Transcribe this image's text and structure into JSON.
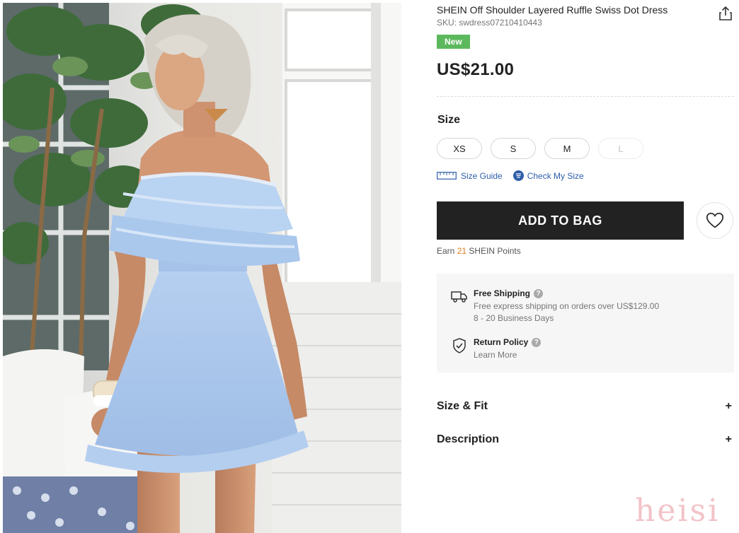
{
  "product": {
    "title": "SHEIN Off Shoulder Layered Ruffle Swiss Dot Dress",
    "sku": "SKU: swdress07210410443",
    "badge": "New",
    "price": "US$21.00",
    "share_icon": "share-icon"
  },
  "size": {
    "label": "Size",
    "options": [
      {
        "label": "XS",
        "available": true
      },
      {
        "label": "S",
        "available": true
      },
      {
        "label": "M",
        "available": true
      },
      {
        "label": "L",
        "available": false
      }
    ],
    "size_guide": "Size Guide",
    "check_my_size": "Check My Size"
  },
  "actions": {
    "add_to_bag": "ADD TO BAG",
    "wishlist_icon": "heart-icon"
  },
  "points": {
    "prefix": "Earn",
    "value": "21",
    "suffix": "SHEIN Points"
  },
  "shipping": {
    "title": "Free Shipping",
    "line1": "Free express shipping on orders over US$129.00",
    "line2": "8 - 20 Business Days",
    "help": "?"
  },
  "returns": {
    "title": "Return Policy",
    "link": "Learn More",
    "help": "?"
  },
  "accordions": [
    {
      "title": "Size & Fit",
      "toggle": "+"
    },
    {
      "title": "Description",
      "toggle": "+"
    }
  ],
  "watermark": "heisi",
  "colors": {
    "badge": "#5cb85c",
    "button": "#222222",
    "link": "#2e5ea8",
    "points": "#e07b1a",
    "dress": "#a9c6ea"
  }
}
